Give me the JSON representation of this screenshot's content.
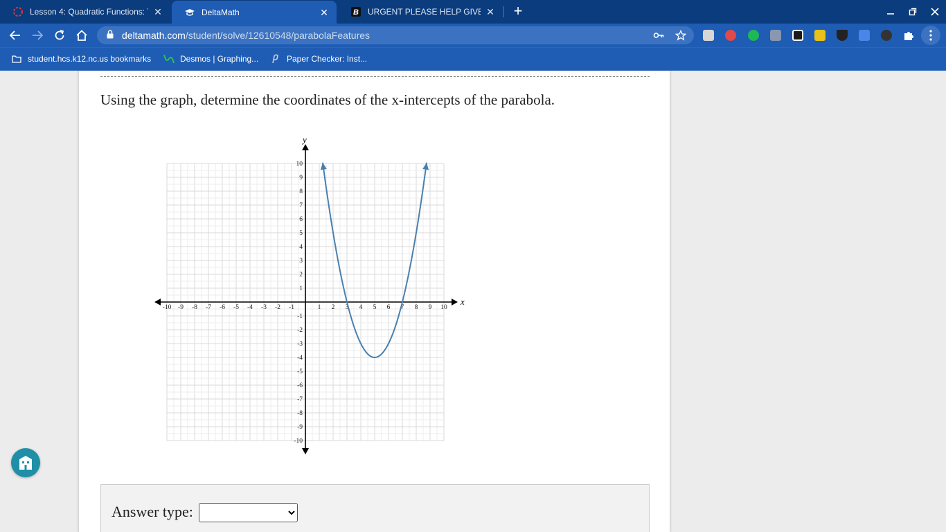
{
  "browser": {
    "tabs": [
      {
        "title": "Lesson 4: Quadratic Functions: T",
        "close": "✕",
        "icon": "loading-ring-icon"
      },
      {
        "title": "DeltaMath",
        "close": "✕",
        "icon": "deltamath-cap-icon"
      },
      {
        "title": "URGENT PLEASE HELP GIVE RIG",
        "close": "✕",
        "icon": "brainly-b-icon"
      }
    ],
    "new_tab": "+",
    "url_host": "deltamath.com",
    "url_path": "/student/solve/12610548/parabolaFeatures",
    "bookmarks": [
      {
        "label": "student.hcs.k12.nc.us bookmarks",
        "icon": "folder-icon"
      },
      {
        "label": "Desmos | Graphing...",
        "icon": "desmos-icon"
      },
      {
        "label": "Paper Checker: Inst...",
        "icon": "paper-checker-icon"
      }
    ],
    "colors": {
      "tabstrip": "#0b3c7d",
      "toolbar": "#1f5cb3"
    }
  },
  "question": "Using the graph, determine the coordinates of the x-intercepts of the parabola.",
  "answer": {
    "label": "Answer type:",
    "selected": ""
  },
  "chart_data": {
    "type": "line",
    "title": "",
    "xlabel": "x",
    "ylabel": "y",
    "xlim": [
      -10,
      10
    ],
    "ylim": [
      -10,
      10
    ],
    "xticks": [
      "-10",
      "-9",
      "-8",
      "-7",
      "-6",
      "-5",
      "-4",
      "-3",
      "-2",
      "-1",
      "1",
      "2",
      "3",
      "4",
      "5",
      "6",
      "7",
      "8",
      "9",
      "10"
    ],
    "yticks": [
      "10",
      "9",
      "8",
      "7",
      "6",
      "5",
      "4",
      "3",
      "2",
      "1",
      "-1",
      "-2",
      "-3",
      "-4",
      "-5",
      "-6",
      "-7",
      "-8",
      "-9",
      "-10"
    ],
    "grid": true,
    "series": [
      {
        "equation": "y = (x - 3)(x - 7)",
        "vertex": [
          5,
          -4
        ],
        "x_range": [
          1.25,
          8.75
        ],
        "color": "#4a7fae"
      }
    ]
  }
}
